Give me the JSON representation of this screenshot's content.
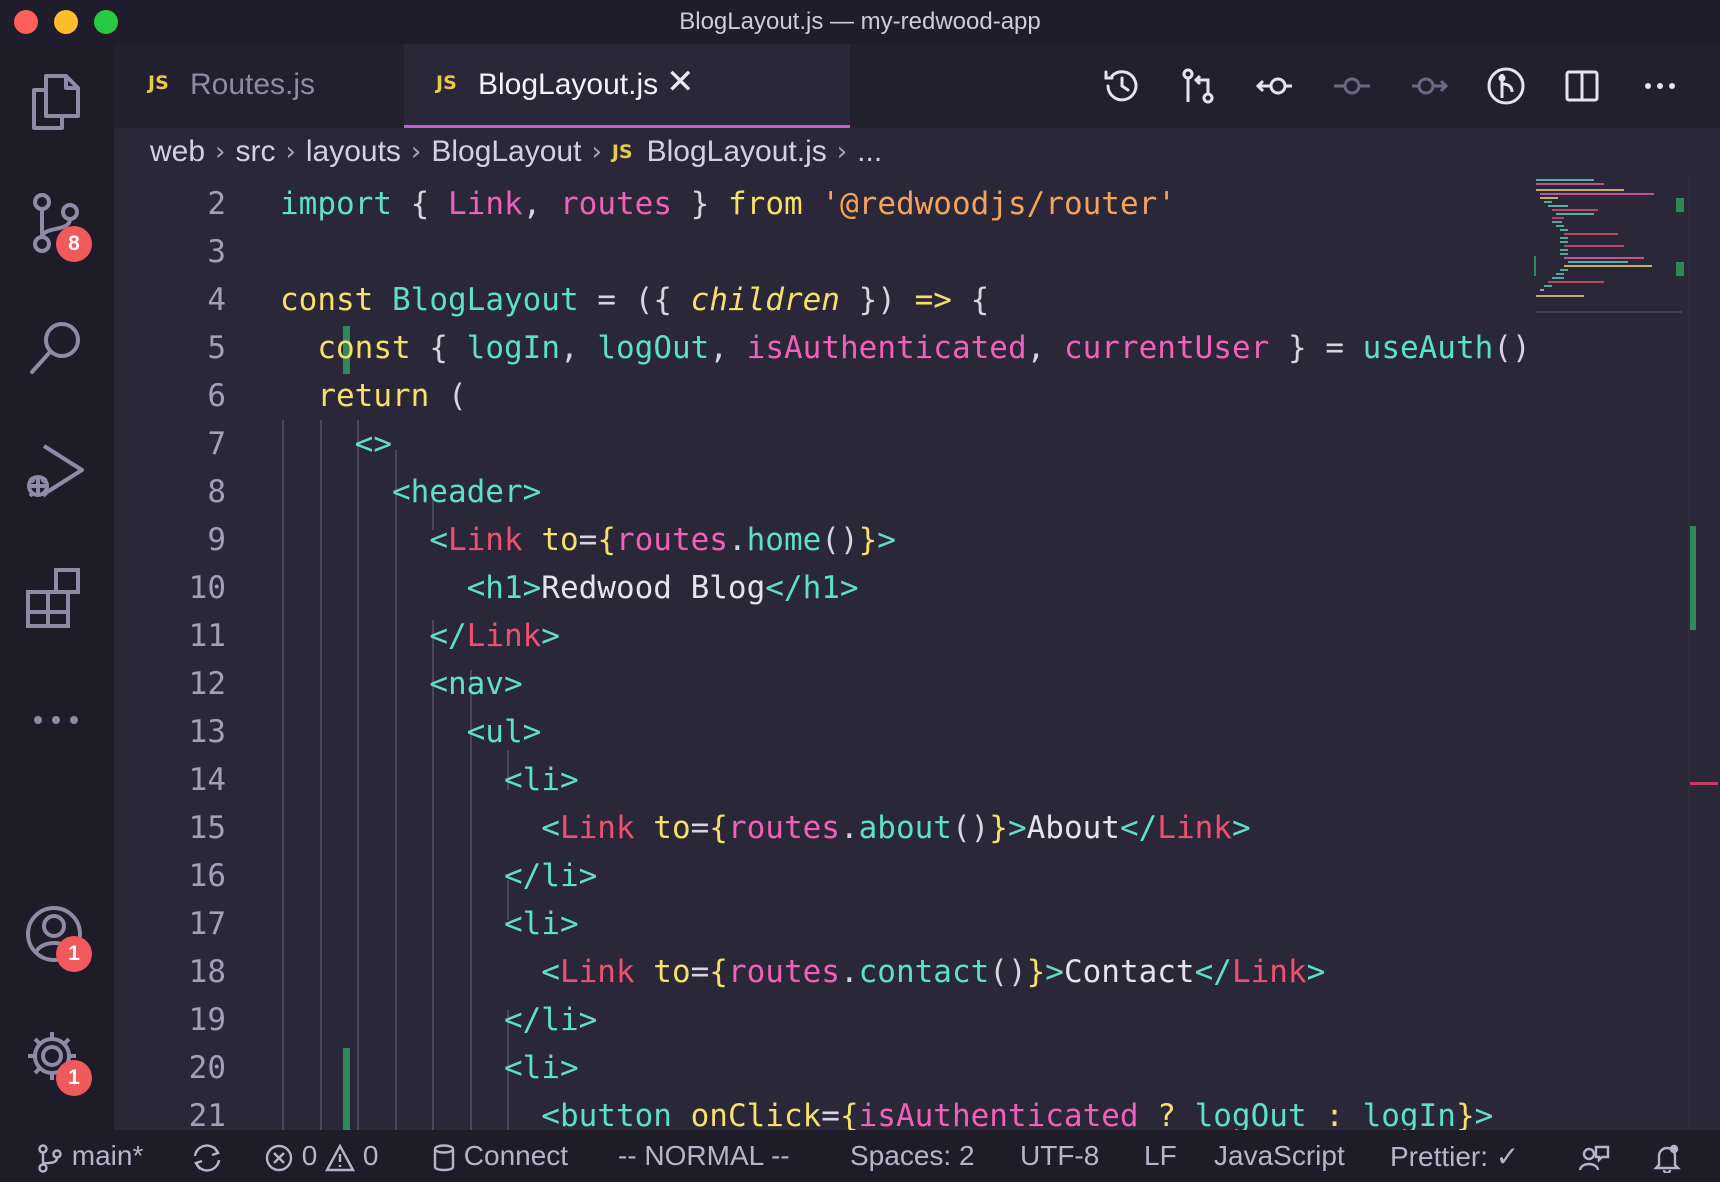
{
  "window": {
    "title": "BlogLayout.js — my-redwood-app"
  },
  "activity_bar": {
    "source_control_badge": "8",
    "accounts_badge": "1",
    "settings_badge": "1"
  },
  "tabs": [
    {
      "badge": "JS",
      "label": "Routes.js"
    },
    {
      "badge": "JS",
      "label": "BlogLayout.js",
      "close": "✕"
    }
  ],
  "breadcrumb": {
    "items": [
      "web",
      "src",
      "layouts",
      "BlogLayout",
      "BlogLayout.js",
      "..."
    ],
    "file_badge": "JS",
    "separator": "›"
  },
  "editor": {
    "line_numbers": [
      "2",
      "3",
      "4",
      "5",
      "6",
      "7",
      "8",
      "9",
      "10",
      "11",
      "12",
      "13",
      "14",
      "15",
      "16",
      "17",
      "18",
      "19",
      "20",
      "21"
    ]
  },
  "statusbar": {
    "branch": "main*",
    "errors": "0",
    "warnings": "0",
    "connect": "Connect",
    "mode": "-- NORMAL --",
    "spaces": "Spaces: 2",
    "encoding": "UTF-8",
    "eol": "LF",
    "language": "JavaScript",
    "prettier": "Prettier: ✓"
  },
  "colors": {
    "accent_tab": "#c55bd8",
    "badge": "#f05a5a",
    "keyword": "#f5e06a",
    "function": "#5ee0c8",
    "variable": "#f161b9",
    "string": "#f3a35b",
    "component": "#f0506e"
  }
}
